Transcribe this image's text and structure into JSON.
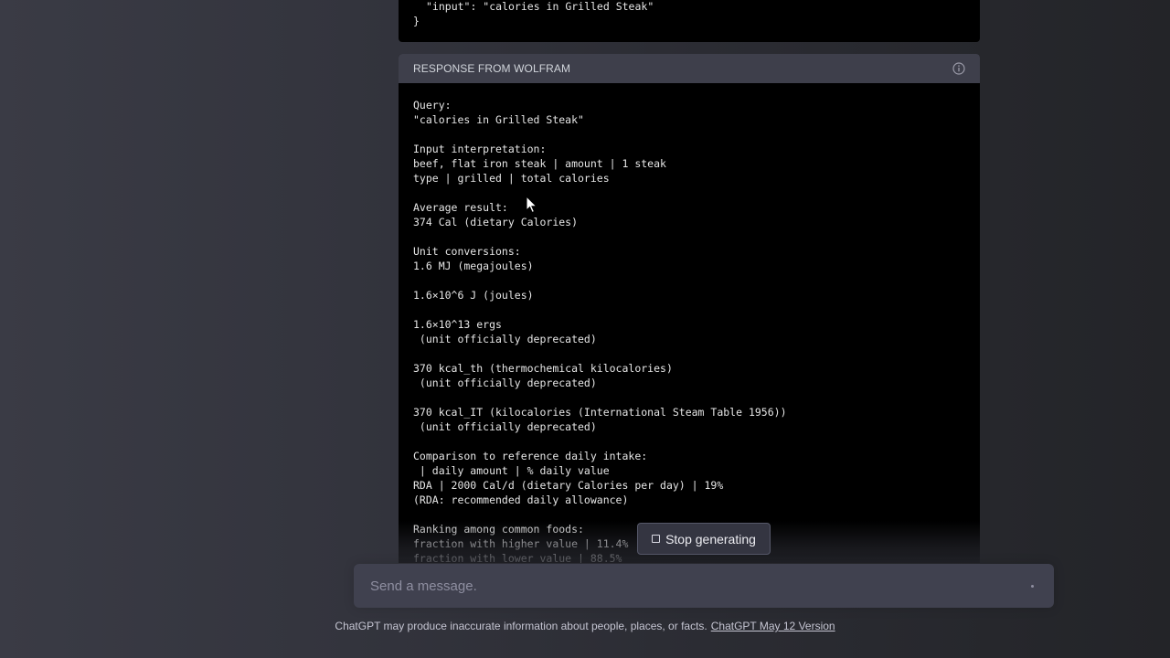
{
  "request_block": {
    "line1": "\"input\": \"calories in Grilled Steak\"",
    "line2": "}"
  },
  "response": {
    "title": "RESPONSE FROM WOLFRAM",
    "info_icon": "info-icon",
    "lines": [
      "Query:",
      "\"calories in Grilled Steak\"",
      "",
      "Input interpretation:",
      "beef, flat iron steak | amount | 1 steak",
      "type | grilled | total calories",
      "",
      "Average result:",
      "374 Cal (dietary Calories)",
      "",
      "Unit conversions:",
      "1.6 MJ (megajoules)",
      "",
      "1.6×10^6 J (joules)",
      "",
      "1.6×10^13 ergs",
      " (unit officially deprecated)",
      "",
      "370 kcal_th (thermochemical kilocalories)",
      " (unit officially deprecated)",
      "",
      "370 kcal_IT (kilocalories (International Steam Table 1956))",
      " (unit officially deprecated)",
      "",
      "Comparison to reference daily intake:",
      " | daily amount | % daily value",
      "RDA | 2000 Cal/d (dietary Calories per day) | 19%",
      "(RDA: recommended daily allowance)",
      "",
      "Ranking among common foods:",
      "fraction with higher value | 11.4%",
      "fraction with lower value | 88.5%"
    ]
  },
  "stop_button": {
    "label": "Stop generating",
    "icon": "stop-icon"
  },
  "composer": {
    "placeholder": "Send a message."
  },
  "footer": {
    "text": "ChatGPT may produce inaccurate information about people, places, or facts.",
    "link": "ChatGPT May 12 Version"
  }
}
